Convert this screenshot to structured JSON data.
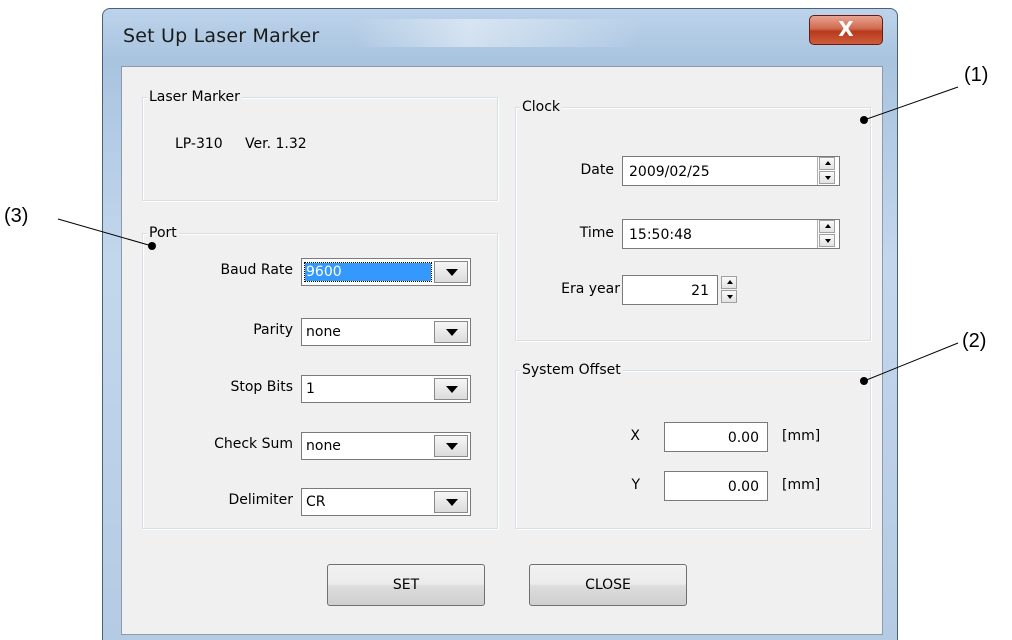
{
  "window": {
    "title": "Set Up Laser Marker",
    "close_label": "X"
  },
  "laser_marker": {
    "label": "Laser Marker",
    "model": "LP-310",
    "version": "Ver. 1.32"
  },
  "port": {
    "label": "Port",
    "baud_rate": {
      "label": "Baud Rate",
      "value": "9600"
    },
    "parity": {
      "label": "Parity",
      "value": "none"
    },
    "stop_bits": {
      "label": "Stop Bits",
      "value": "1"
    },
    "check_sum": {
      "label": "Check Sum",
      "value": "none"
    },
    "delimiter": {
      "label": "Delimiter",
      "value": "CR"
    }
  },
  "clock": {
    "label": "Clock",
    "date": {
      "label": "Date",
      "value": "2009/02/25"
    },
    "time": {
      "label": "Time",
      "value": "15:50:48"
    },
    "era_year": {
      "label": "Era year",
      "value": "21"
    }
  },
  "system_offset": {
    "label": "System Offset",
    "x": {
      "label": "X",
      "value": "0.00",
      "unit": "[mm]"
    },
    "y": {
      "label": "Y",
      "value": "0.00",
      "unit": "[mm]"
    }
  },
  "buttons": {
    "set": "SET",
    "close": "CLOSE"
  },
  "callouts": {
    "one": "(1)",
    "two": "(2)",
    "three": "(3)"
  }
}
